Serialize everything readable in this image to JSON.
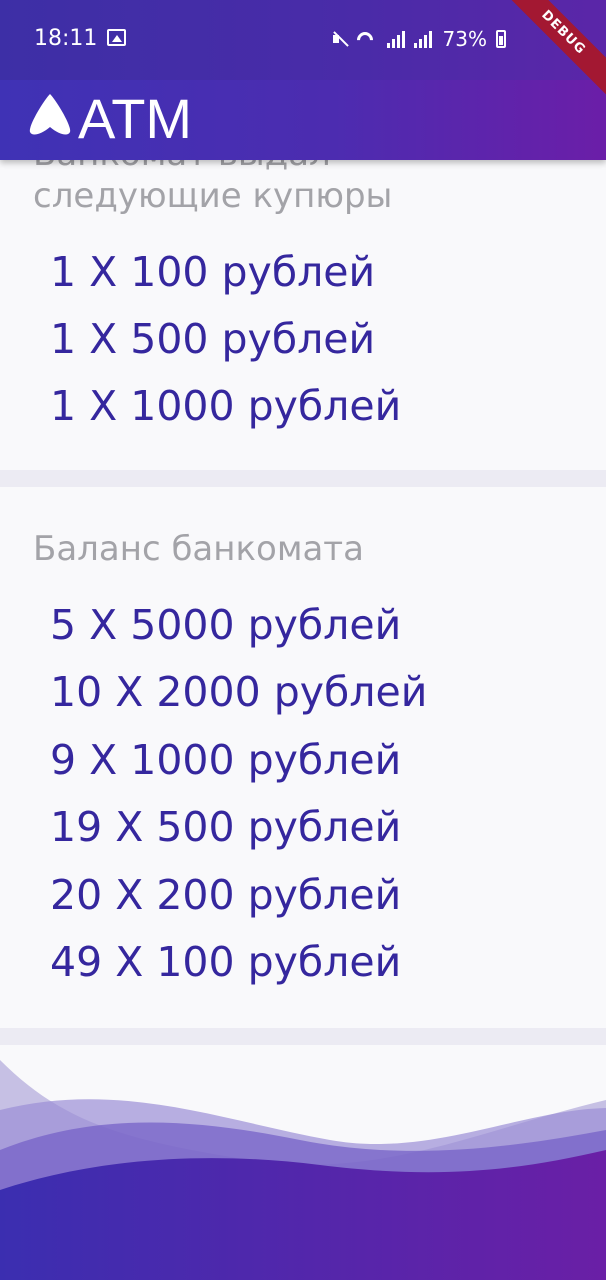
{
  "status_bar": {
    "time": "18:11",
    "battery": "73%"
  },
  "debug_banner": "DEBUG",
  "app_bar": {
    "title": "ATM"
  },
  "withdraw_card": {
    "title_cut": "Банкомат выдал",
    "title": "следующие купюры",
    "lines": [
      "1 X 100 рублей",
      "1 X 500 рублей",
      "1 X 1000 рублей"
    ]
  },
  "balance_card": {
    "title": "Баланс банкомата",
    "lines": [
      "5 X 5000 рублей",
      "10 X 2000 рублей",
      "9 X 1000 рублей",
      "19 X 500 рублей",
      "20 X 200 рублей",
      "49 X 100 рублей"
    ]
  },
  "colors": {
    "accent": "#35279e",
    "gradient_start": "#3f32b5",
    "gradient_end": "#6b1ea8",
    "muted_text": "#a3a3a8",
    "debug_red": "#a31832"
  },
  "icons": [
    "image-icon",
    "mute-icon",
    "wifi-icon",
    "signal-icon",
    "battery-icon",
    "atm-logo-icon"
  ]
}
